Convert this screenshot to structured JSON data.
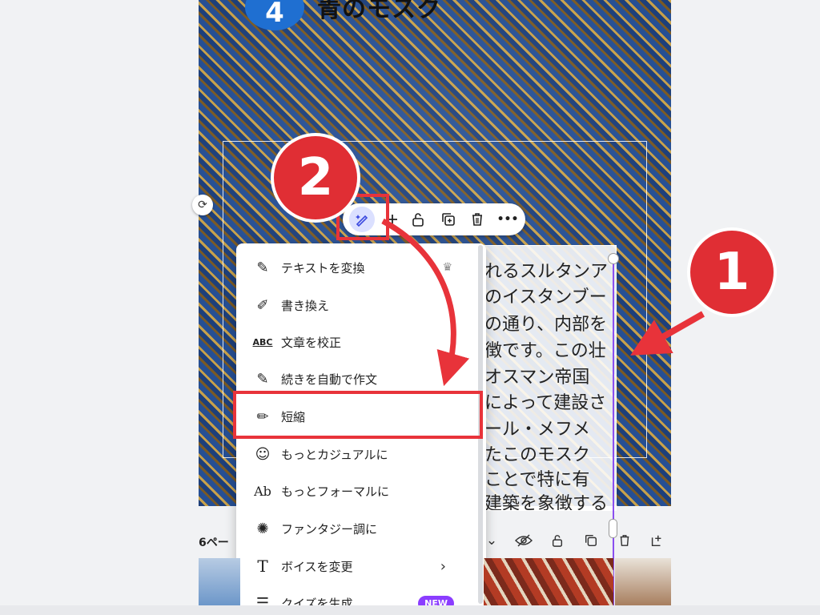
{
  "design": {
    "page_number": "4",
    "heading": "青のモスク",
    "text_lines": [
      "れるスルタンア",
      "のイスタンブー",
      "の通り、内部を",
      "徴です。この壮",
      "オスマン帝国",
      "によって建設さ",
      "ール・メフメ",
      "たこのモスク",
      "ことで特に有",
      "建築を象徴する"
    ]
  },
  "toolbar": {
    "magic_icon": "magic-write-icon",
    "more_label": "•••"
  },
  "menu": {
    "items": [
      {
        "label": "テキストを変換",
        "icon": "sparkle-pen-icon",
        "extra": "crown"
      },
      {
        "label": "書き換え",
        "icon": "rewrite-icon"
      },
      {
        "label": "文章を校正",
        "icon": "abc-icon",
        "icon_text": "ABC"
      },
      {
        "label": "続きを自動で作文",
        "icon": "continue-writing-icon"
      },
      {
        "label": "短縮",
        "icon": "pencil-icon"
      },
      {
        "label": "もっとカジュアルに",
        "icon": "smiley-icon"
      },
      {
        "label": "もっとフォーマルに",
        "icon": "ab-icon",
        "icon_text": "Ab"
      },
      {
        "label": "ファンタジー調に",
        "icon": "fantasy-icon"
      },
      {
        "label": "ボイスを変更",
        "icon": "voice-icon",
        "extra": "chevron"
      },
      {
        "label": "クイズを生成",
        "icon": "quiz-icon",
        "badge": "NEW"
      }
    ]
  },
  "pages": {
    "label": "6ペー"
  },
  "annotations": {
    "step1": "1",
    "step2": "2",
    "accent": "#e02e34"
  }
}
